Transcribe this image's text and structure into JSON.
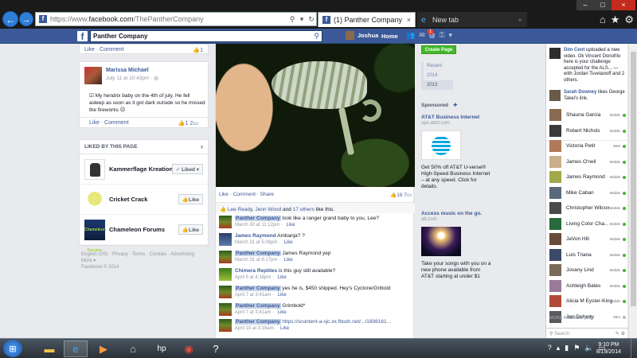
{
  "browser": {
    "url_prefix": "https://www.",
    "url_host": "facebook.com",
    "url_path": "/ThePantherCompany",
    "search_icon": "search-icon",
    "refresh_icon": "refresh-icon",
    "tabs": [
      {
        "label": "(1) Panther Company",
        "close": "×"
      },
      {
        "label": "New tab"
      }
    ],
    "window": {
      "minimize": "–",
      "maximize": "□",
      "close": "×"
    }
  },
  "fbbar": {
    "search_value": "Panther Company",
    "user_name": "Joshua",
    "home_label": "Home",
    "notification_count": "1"
  },
  "left": {
    "top_post": {
      "actions": "Like · Comment",
      "likes": "1"
    },
    "marissa_post": {
      "author": "Marissa Michael",
      "time": "July 11 at 10:43pm · ",
      "body": "☑ My hendrix baby on the 4th of july. He fell asleep as soon as it got dark outside so he missed the fireworks ☹",
      "actions": "Like · Comment",
      "counts": "1   2"
    },
    "likes_header": "LIKED BY THIS PAGE",
    "liked_pages": [
      {
        "name": "Kammerflage Kreations",
        "button": "✓ Liked ▾"
      },
      {
        "name": "Cricket Crack",
        "button": "Like"
      },
      {
        "name": "Chameleon Forums",
        "button": "Like"
      }
    ],
    "chameleon_logo_text": "Chameleon Forums",
    "footer_line1": "English (US) · Privacy · Terms · Cookies · Advertising",
    "footer_line2": "More ▾",
    "footer_line3": "Facebook © 2014"
  },
  "center": {
    "photo_actions": "Like · Comment · Share",
    "photo_counts": "19   7",
    "likes_line": {
      "people": "Lee Ready, Jenn Wood",
      "and": " and ",
      "others": "17 others",
      "tail": " like this."
    },
    "comments": [
      {
        "author": "Panther Company",
        "text": " look like a ranger grand baby to you, Lee?",
        "time": "March 30 at 11:12pm",
        "like": "Like",
        "highlight": true
      },
      {
        "author": "James Raymond",
        "text": " Ambanja? ?",
        "time": "March 31 at 5:06pm",
        "like": "Like",
        "highlight": false
      },
      {
        "author": "Panther Company",
        "text": " James Raymond yep",
        "time": "March 31 at 6:17pm",
        "like": "Like",
        "highlight": true
      },
      {
        "author": "Chimera Reptiles",
        "text": " is this guy still available?",
        "time": "April 5 at 4:18pm",
        "like": "Like",
        "highlight": false
      },
      {
        "author": "Panther Company",
        "text": " yes he is, $450 shipped. Hey's Cyclone/Gribold",
        "time": "April 7 at 3:41am",
        "like": "Like",
        "highlight": true
      },
      {
        "author": "Panther Company",
        "text": " Grimbold*",
        "time": "April 7 at 3:41am",
        "like": "Like",
        "highlight": true
      },
      {
        "author": "Panther Company",
        "text": " https://scontent-a-sjc.xx.fbcdn.net/.../1898161...",
        "time": "April 10 at 3:16am",
        "like": "Like",
        "highlight": true
      }
    ]
  },
  "ads": {
    "create_page": "Create Page",
    "years": [
      "Recent",
      "2014",
      "2013"
    ],
    "sponsored": "Sponsored",
    "sponsored_plus": "✚",
    "ad1": {
      "title": "AT&T Business Internet",
      "domain": "ups.attnt.com",
      "text": "Get 50% off AT&T U-verse® High-Speed Business Internet – at any speed. Click for details."
    },
    "ad2": {
      "title": "Access music on the go.",
      "domain": "att.com",
      "text": "Take your songs with you on a new phone available from AT&T starting at under $1"
    }
  },
  "chat": {
    "ticker": [
      {
        "name": "Dim Cent",
        "text": " uploaded a new video. Ok Vincent Donofrio here is your challenge accepted for the ALS... — with Jordan Tsvetanoff and 2 others."
      },
      {
        "name": "Sarah Downey",
        "text": " likes George Takei's link."
      }
    ],
    "friends": [
      {
        "name": "Shauna Garcia",
        "status": "Mobile",
        "online": true
      },
      {
        "name": "Robert Nichols",
        "status": "Mobile",
        "online": true
      },
      {
        "name": "Victoria Petit",
        "status": "Web",
        "online": true
      },
      {
        "name": "James O'neil",
        "status": "Mobile",
        "online": true
      },
      {
        "name": "James Raymond",
        "status": "Mobile",
        "online": true
      },
      {
        "name": "Mike Caban",
        "status": "Mobile",
        "online": true
      },
      {
        "name": "Christopher Wilcox",
        "status": "Mobile",
        "online": true
      },
      {
        "name": "Living Color Cha...",
        "status": "Mobile",
        "online": true
      },
      {
        "name": "JaVon Hill",
        "status": "Mobile",
        "online": true
      },
      {
        "name": "Luis Triana",
        "status": "Mobile",
        "online": true
      },
      {
        "name": "Jovany Lind",
        "status": "Mobile",
        "online": true
      },
      {
        "name": "Ashleigh Bates",
        "status": "Mobile",
        "online": true
      },
      {
        "name": "Alicia M Eyster-King",
        "status": "Mobile",
        "online": true
      },
      {
        "name": "Jan Doherty",
        "status": "55m",
        "online": false
      }
    ],
    "more_friends": "MORE FRIENDS (39)",
    "search_placeholder": "Search",
    "search_icons": "✎ ⚙"
  },
  "taskbar": {
    "hp_label": "hp",
    "help_label": "?",
    "time": "9:10 PM",
    "date": "8/19/2014"
  },
  "colors": {
    "facebook_blue": "#3b5998",
    "create_green": "#42b72a",
    "online_green": "#42b72a"
  }
}
